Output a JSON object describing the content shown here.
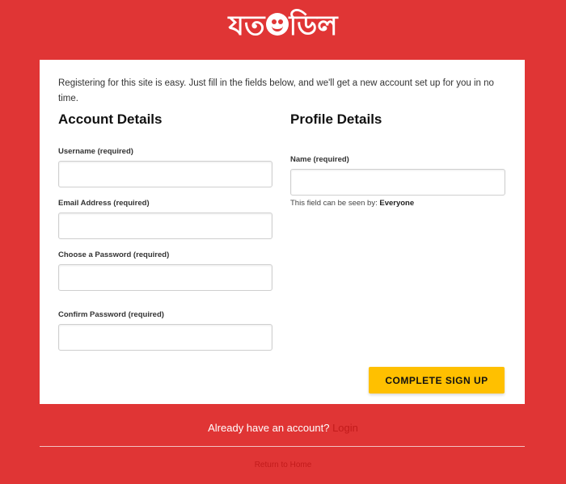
{
  "header": {
    "logo_part1": "যত",
    "logo_part2": "ডিল"
  },
  "form": {
    "intro": "Registering for this site is easy. Just fill in the fields below, and we'll get a new account set up for you in no time.",
    "account": {
      "heading": "Account Details",
      "username_label": "Username (required)",
      "username_value": "",
      "email_label": "Email Address (required)",
      "email_value": "",
      "password_label": "Choose a Password (required)",
      "password_value": "",
      "confirm_label": "Confirm Password (required)",
      "confirm_value": ""
    },
    "profile": {
      "heading": "Profile Details",
      "name_label": "Name (required)",
      "name_value": "",
      "visibility_prefix": "This field can be seen by:",
      "visibility_value": "Everyone"
    },
    "submit_label": "COMPLETE SIGN UP"
  },
  "footer": {
    "already_text": "Already have an account?",
    "login_link": "Login",
    "home_link": "Return to Home"
  },
  "colors": {
    "background": "#e03535",
    "button": "#ffc000",
    "link": "#c21b1b"
  }
}
